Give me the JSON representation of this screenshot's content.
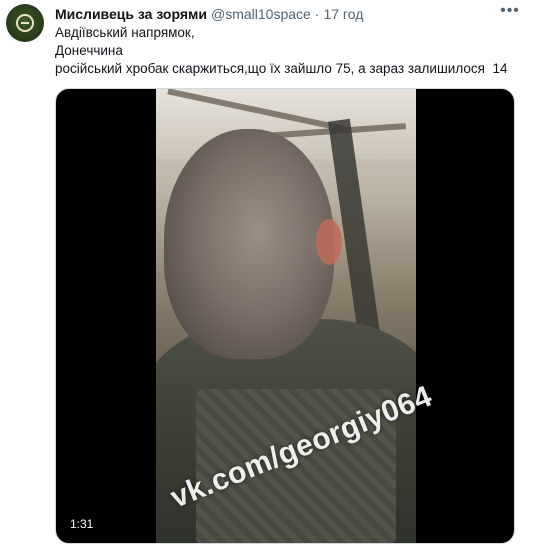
{
  "tweet": {
    "avatar_icon": "army-emblem-avatar",
    "display_name": "Мисливець за зорями",
    "handle": "@small10space",
    "separator": "·",
    "time": "17 год",
    "more_icon": "more-icon",
    "text_lines": [
      "Авдіївський напрямок,",
      "Донеччина",
      "російський хробак скаржиться,що їх зайшло 75, а зараз залишилося  14"
    ]
  },
  "media": {
    "type": "video",
    "watermark": "vk.com/georgiy064",
    "duration": "1:31"
  },
  "colors": {
    "text_primary": "#0f1419",
    "text_secondary": "#536471",
    "media_background": "#000000",
    "border": "#cfd9de"
  }
}
